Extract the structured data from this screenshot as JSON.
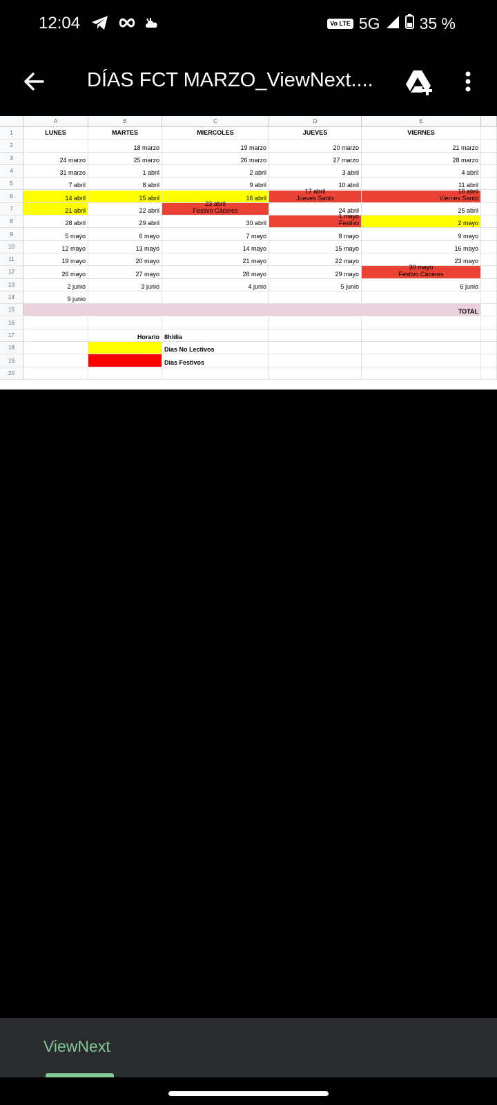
{
  "status_bar": {
    "time": "12:04",
    "icons": [
      "telegram-icon",
      "infinity-icon",
      "cloud-icon"
    ],
    "volte": "Vo LTE",
    "network": "5G",
    "battery": "35 %"
  },
  "app_bar": {
    "title": "DÍAS FCT MARZO_ViewNext....",
    "icons": [
      "back-arrow-icon",
      "drive-add-icon",
      "more-vert-icon"
    ]
  },
  "sheet": {
    "columns": [
      "A",
      "B",
      "C",
      "D",
      "E"
    ],
    "rows": [
      "1",
      "2",
      "3",
      "4",
      "5",
      "6",
      "7",
      "8",
      "9",
      "10",
      "11",
      "12",
      "13",
      "14",
      "15",
      "16",
      "17",
      "18",
      "19",
      "20"
    ],
    "headers": [
      "LUNES",
      "MARTES",
      "MIERCOLES",
      "JUEVES",
      "VIERNES"
    ],
    "data": [
      [
        "",
        "18 marzo",
        "19 marzo",
        "20 marzo",
        "21 marzo"
      ],
      [
        "24 marzo",
        "25 marzo",
        "26 marzo",
        "27 marzo",
        "28 marzo"
      ],
      [
        "31 marzo",
        "1 abril",
        "2 abril",
        "3 abril",
        "4 abril"
      ],
      [
        "7 abril",
        "8 abril",
        "9 abril",
        "10 abril",
        "11 abril"
      ],
      [
        "14 abril",
        "15 abril",
        "16 abril",
        "17 abril|Jueves Santo",
        "18 abril|Viernes Santo"
      ],
      [
        "21 abril",
        "22 abril",
        "23 abril|Festivo Cáceres",
        "24 abril",
        "25 abril"
      ],
      [
        "28 abril",
        "29 abril",
        "30 abril",
        "1 mayo|Festivo",
        "2 mayo"
      ],
      [
        "5 mayo",
        "6 mayo",
        "7 mayo",
        "8 mayo",
        "9 mayo"
      ],
      [
        "12 mayo",
        "13 mayo",
        "14 mayo",
        "15 mayo",
        "16 mayo"
      ],
      [
        "19 mayo",
        "20 mayo",
        "21 mayo",
        "22 mayo",
        "23 mayo"
      ],
      [
        "26 mayo",
        "27 mayo",
        "28 mayo",
        "29 mayo",
        "30 mayo|Festivo Cáceres"
      ],
      [
        "2 junio",
        "3 junio",
        "4 junio",
        "5 junio",
        "6 junio"
      ],
      [
        "9 junio",
        "",
        "",
        "",
        ""
      ]
    ],
    "total_label": "TOTAL",
    "legend": {
      "horario_label": "Horario",
      "horario_value": "8h/dia",
      "no_lectivos": "Días No Lectivos",
      "festivos": "Días Festivos"
    },
    "colors": {
      "no_lectivo": "#ffff00",
      "festivo_cell": "#ea4335",
      "festivo_legend": "#ff0000",
      "total_row": "#ead1dc"
    }
  },
  "bottom_panel": {
    "label": "ViewNext"
  }
}
